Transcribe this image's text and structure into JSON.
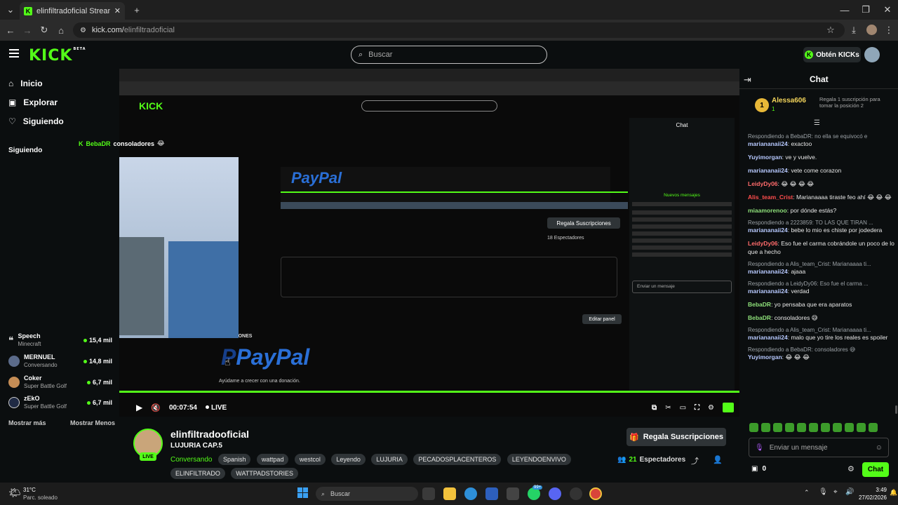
{
  "browser": {
    "tab_title": "elinfiltradoficial Stream - Watc",
    "url_domain": "kick.com/",
    "url_path": "elinfiltradoficial"
  },
  "header": {
    "logo": "KICK",
    "logo_badge": "BETA",
    "search_placeholder": "Buscar",
    "kicks_button": "Obtén KICKs"
  },
  "sidebar": {
    "nav": [
      {
        "label": "Inicio",
        "icon": "home-icon"
      },
      {
        "label": "Explorar",
        "icon": "explore-icon"
      },
      {
        "label": "Siguiendo",
        "icon": "heart-icon"
      }
    ],
    "section_title": "Siguiendo",
    "overlay_chat": {
      "user": "BebaDR",
      "text": "consoladores"
    },
    "followed": [
      {
        "name": "Speech",
        "category": "Minecraft",
        "viewers": "15,4 mil"
      },
      {
        "name": "MERNUEL",
        "category": "Conversando",
        "viewers": "14,8 mil"
      },
      {
        "name": "Coker",
        "category": "Super Battle Golf",
        "viewers": "6,7 mil"
      },
      {
        "name": "zEkO",
        "category": "Super Battle Golf",
        "viewers": "6,7 mil"
      }
    ],
    "show_more": "Mostrar más",
    "show_less": "Mostrar Menos"
  },
  "player": {
    "time": "00:07:54",
    "live_label": "LIVE",
    "progress_fraction": 1.0
  },
  "inner_screen": {
    "paypal_label": "PayPal",
    "donation_text": "Ayúdame a crecer con una donación.",
    "donations_heading": "DONACIONES",
    "edit_panel": "Editar panel",
    "inner_subs": "Regala Suscripciones",
    "inner_viewers": "18 Espectadores",
    "inner_chat_input": "Enviar un mensaje",
    "inner_new_messages": "Nuevos mensajes"
  },
  "stream": {
    "channel": "elinfiltradooficial",
    "title": "LUJURIA CAP.5",
    "category": "Conversando",
    "tags": [
      "Spanish",
      "wattpad",
      "westcol",
      "Leyendo",
      "LUJURIA",
      "PECADOSPLACENTEROS",
      "LEYENDOENVIVO",
      "ELINFILTRADO",
      "WATTPADSTORIES"
    ],
    "live_badge": "LIVE",
    "subs_button": "Regala Suscripciones",
    "viewers_count": "21",
    "viewers_label": "Espectadores"
  },
  "chat": {
    "title": "Chat",
    "pinned": {
      "rank": "1",
      "user": "Alessa606",
      "gifts": "1",
      "text": "Regala 1 suscripción para tomar la posición 2"
    },
    "messages": [
      {
        "reply": "Respondiendo a BebaDR: no ella se equivocó e",
        "user": "mariananaii24",
        "color": "#b7c9ff",
        "text": "exactoo"
      },
      {
        "reply": "",
        "user": "Yuyimorgan",
        "color": "#b7c9ff",
        "text": "ve y vuelve."
      },
      {
        "reply": "",
        "user": "mariananaii24",
        "color": "#b7c9ff",
        "text": "vete come corazon"
      },
      {
        "reply": "",
        "user": "LeidyDy06",
        "color": "#ff6b6b",
        "text": "😂 😂 😂 😂"
      },
      {
        "reply": "",
        "user": "Alis_team_Crist",
        "color": "#ff4d4d",
        "text": "Marianaaaa tiraste feo ahí 😂 😂 😂"
      },
      {
        "reply": "",
        "user": "miaamorenoo",
        "color": "#8ee07a",
        "text": "por dónde estás?"
      },
      {
        "reply": "Respondiendo a 2223859: TO LAS QUE TIRAN ...",
        "user": "mariananaii24",
        "color": "#b7c9ff",
        "text": "bebe lo mio es chiste por jodedera"
      },
      {
        "reply": "",
        "user": "LeidyDy06",
        "color": "#ff6b6b",
        "text": "Eso fue el carma cobrándole un poco de lo que a hecho"
      },
      {
        "reply": "Respondiendo a Alis_team_Crist: Marianaaaa ti...",
        "user": "mariananaii24",
        "color": "#b7c9ff",
        "text": "ajaaa"
      },
      {
        "reply": "Respondiendo a LeidyDy06: Eso fue el carma ...",
        "user": "mariananaii24",
        "color": "#b7c9ff",
        "text": "verdad"
      },
      {
        "reply": "",
        "user": "BebaDR",
        "color": "#8ee07a",
        "text": "yo pensaba que era aparatos"
      },
      {
        "reply": "",
        "user": "BebaDR",
        "color": "#8ee07a",
        "text": "consoladores 😅"
      },
      {
        "reply": "Respondiendo a Alis_team_Crist: Marianaaaa ti...",
        "user": "mariananaii24",
        "color": "#b7c9ff",
        "text": "malo que yo tire los reales es spoiler"
      },
      {
        "reply": "Respondiendo a BebaDR: consoladores 😅",
        "user": "Yuyimorgan",
        "color": "#b7c9ff",
        "text": "😂 😂 😂"
      }
    ],
    "input_placeholder": "Enviar un mensaje",
    "points": "0",
    "send_button": "Chat"
  },
  "taskbar": {
    "weather_temp": "31°C",
    "weather_desc": "Parc. soleado",
    "search_placeholder": "Buscar",
    "time": "3:49",
    "date": "27/02/2026",
    "badge": "99+"
  },
  "colors": {
    "accent": "#53fc18",
    "bg": "#0b0e0f"
  }
}
